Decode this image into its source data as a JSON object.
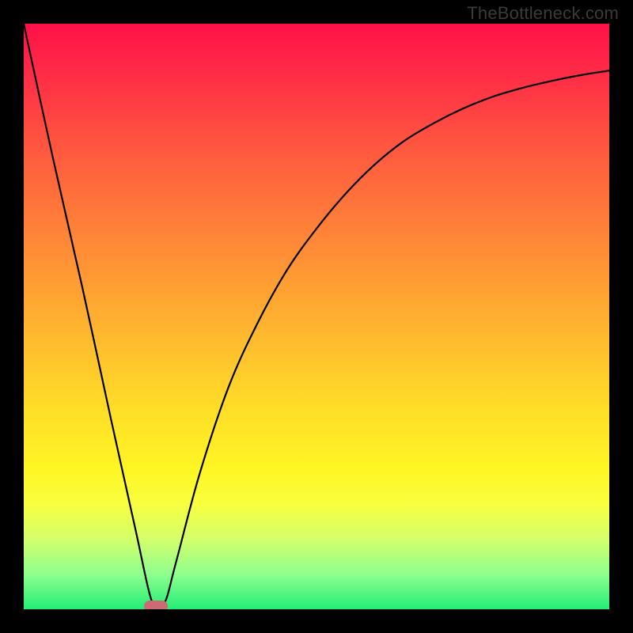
{
  "watermark": "TheBottleneck.com",
  "colors": {
    "page_bg": "#000000",
    "curve": "#000000",
    "marker": "#cc6b71",
    "gradient_top": "#ff1146",
    "gradient_bottom": "#22ee77"
  },
  "chart_data": {
    "type": "line",
    "title": "",
    "xlabel": "",
    "ylabel": "",
    "xlim": [
      0,
      100
    ],
    "ylim": [
      0,
      100
    ],
    "grid": false,
    "legend": false,
    "series": [
      {
        "name": "curve",
        "x": [
          0,
          5,
          10,
          15,
          19,
          22,
          24,
          26,
          30,
          35,
          40,
          45,
          50,
          55,
          60,
          65,
          70,
          75,
          80,
          85,
          90,
          95,
          100
        ],
        "y": [
          100,
          77,
          55,
          32,
          14,
          1,
          1,
          8,
          23,
          38,
          49,
          58,
          65,
          71,
          76,
          80,
          83,
          85.5,
          87.5,
          89,
          90.2,
          91.2,
          92
        ]
      }
    ],
    "marker": {
      "x": 22.5,
      "y": 0.5
    },
    "background_gradient": {
      "orientation": "vertical",
      "stops": [
        {
          "pos": 0.0,
          "color": "#ff1146"
        },
        {
          "pos": 0.22,
          "color": "#ff5a3f"
        },
        {
          "pos": 0.52,
          "color": "#ffb52f"
        },
        {
          "pos": 0.76,
          "color": "#fff524"
        },
        {
          "pos": 0.94,
          "color": "#8fff8f"
        },
        {
          "pos": 1.0,
          "color": "#22ee77"
        }
      ]
    }
  }
}
